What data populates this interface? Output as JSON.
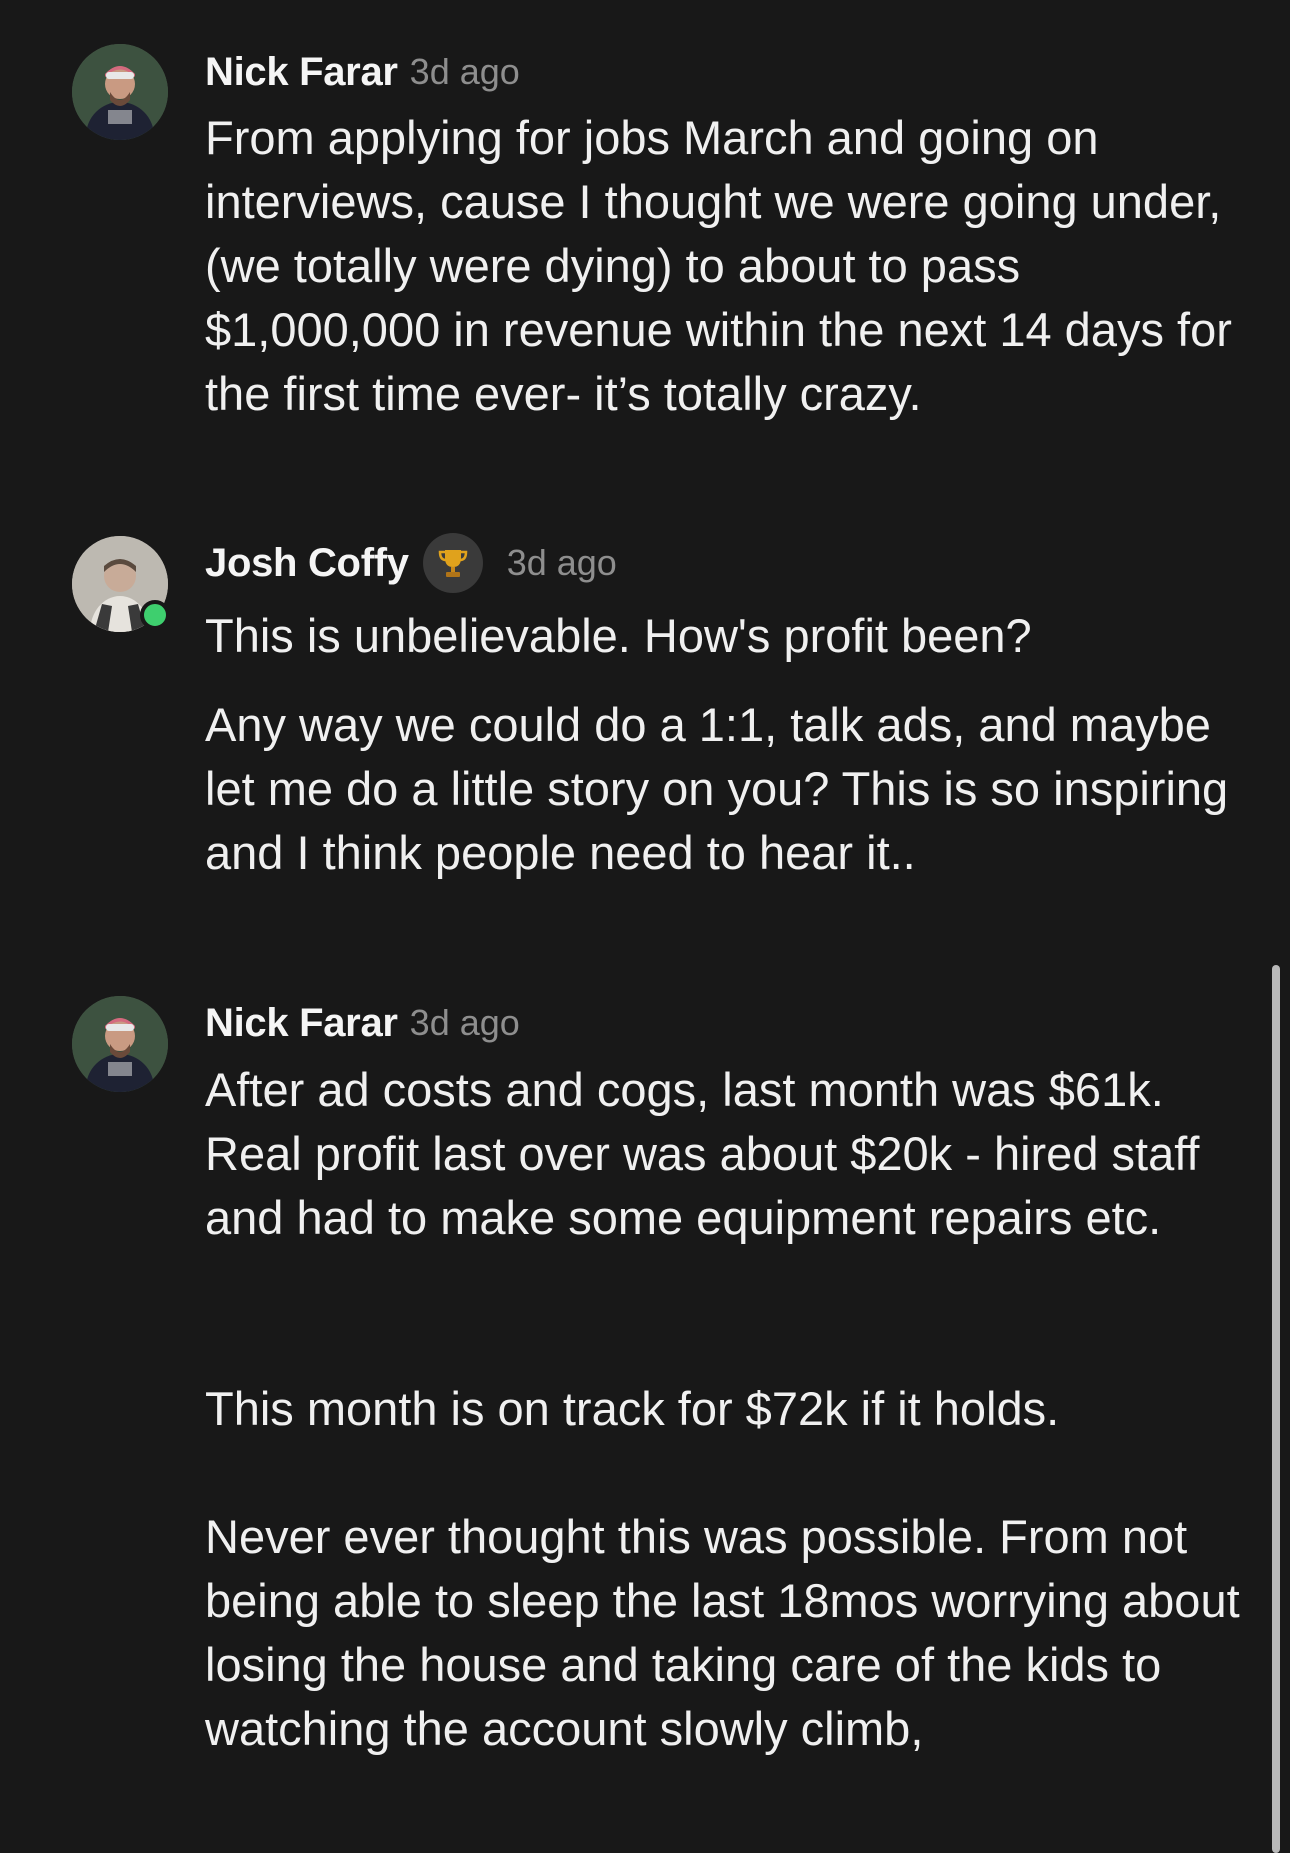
{
  "messages": [
    {
      "author": "Nick Farar",
      "time": "3d ago",
      "avatar_icon": "avatar-photo",
      "body": "From applying for jobs March and going on interviews, cause I thought we were going under, (we totally were dying) to about to pass $1,000,000 in revenue within the next 14 days for the first time ever- it’s totally crazy."
    },
    {
      "author": "Josh Coffy",
      "time": "3d ago",
      "avatar_icon": "avatar-photo",
      "badge_icon": "trophy-icon",
      "online": true,
      "paragraphs": [
        "This is unbelievable. How's profit been?",
        "Any way we could do a 1:1, talk ads, and maybe let me do a little story on you? This is so inspiring and I think people need to hear it.."
      ]
    },
    {
      "author": "Nick Farar",
      "time": "3d ago",
      "avatar_icon": "avatar-photo",
      "paragraphs": [
        "After ad costs and cogs, last month was $61k. Real profit last over was about $20k - hired staff and had to make some equipment repairs etc.",
        "This month is on track for $72k if it holds.",
        "Never ever thought this was possible. From not being able to sleep the last 18mos worrying about losing the house and taking care of the kids to watching the account slowly climb,"
      ]
    }
  ],
  "colors": {
    "background": "#181818",
    "text": "#f0f0f0",
    "timestamp": "#8e8e8e",
    "online": "#3ecf6e",
    "badge_bg": "#3a3a3a"
  }
}
